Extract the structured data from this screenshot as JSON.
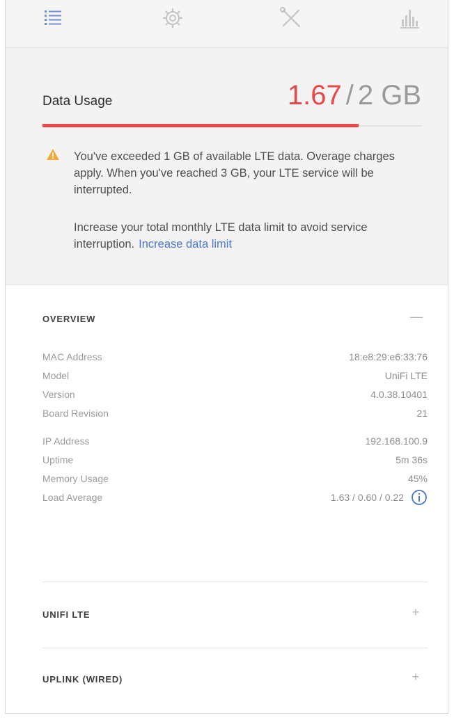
{
  "tabs": [
    {
      "icon": "list-icon"
    },
    {
      "icon": "gear-icon"
    },
    {
      "icon": "tools-icon"
    },
    {
      "icon": "stats-icon"
    }
  ],
  "usage": {
    "title": "Data Usage",
    "used": "1.67",
    "separator": "/",
    "total": "2 GB",
    "used_fraction": 0.835,
    "accent_color": "#e84848",
    "warning_icon": "warning-triangle-icon",
    "warning_color": "#f1a93a",
    "warning_text": "You've exceeded 1 GB of available LTE data. Overage charges apply. When you've reached 3 GB, your LTE service will be interrupted.",
    "help_text": "Increase your total monthly LTE data limit to avoid service interruption.",
    "help_link": "Increase data limit",
    "link_color": "#4a76c8"
  },
  "overview": {
    "title": "OVERVIEW",
    "toggle": "—",
    "rows": [
      {
        "label": "MAC Address",
        "value": "18:e8:29:e6:33:76"
      },
      {
        "label": "Model",
        "value": "UniFi LTE"
      },
      {
        "label": "Version",
        "value": "4.0.38.10401"
      },
      {
        "label": "Board Revision",
        "value": "21"
      },
      {
        "label": "IP Address",
        "value": "192.168.100.9"
      },
      {
        "label": "Uptime",
        "value": "5m 36s"
      },
      {
        "label": "Memory Usage",
        "value": "45%"
      },
      {
        "label": "Load Average",
        "value": "1.63 / 0.60 / 0.22",
        "icon": "info-icon"
      }
    ]
  },
  "sections": [
    {
      "title": "UNIFI LTE",
      "toggle": "+"
    },
    {
      "title": "UPLINK (WIRED)",
      "toggle": "+"
    }
  ]
}
